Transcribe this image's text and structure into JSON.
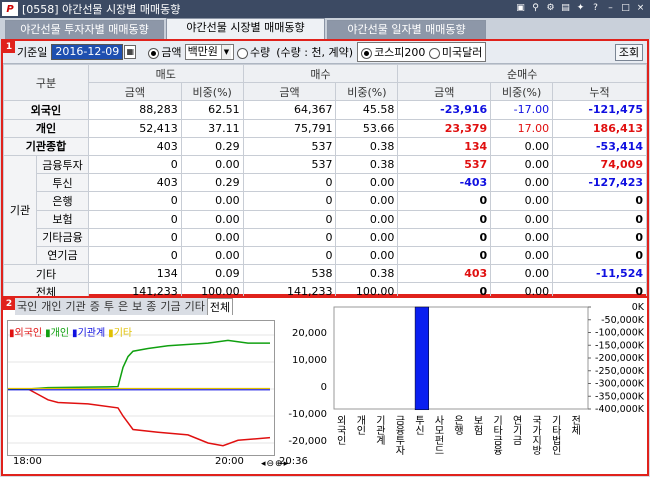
{
  "window": {
    "title": "[0558] 야간선물 시장별 매매동향",
    "app_icon": "P"
  },
  "tabs": [
    "야간선물 투자자별 매매동향",
    "야간선물 시장별 매매동향",
    "야간선물 일자별 매매동향"
  ],
  "filter": {
    "date_label": "기준일",
    "date": "2016-12-09",
    "amount_label": "금액",
    "unit": "백만원",
    "qty_label": "수량",
    "qty_note": "(수량 : 천, 계약)",
    "kospi": "코스피200",
    "usd": "미국달러",
    "query": "조회"
  },
  "grid": {
    "h1": [
      "구분",
      "매도",
      "매수",
      "순매수"
    ],
    "h2": [
      "금액",
      "비중(%)",
      "금액",
      "비중(%)",
      "금액",
      "비중(%)",
      "누적"
    ],
    "group_label": "기관",
    "rows": [
      {
        "name": "외국인",
        "v": [
          "88,283",
          "62.51",
          "64,367",
          "45.58",
          "-23,916",
          "-17.00",
          "-121,475"
        ]
      },
      {
        "name": "개인",
        "v": [
          "52,413",
          "37.11",
          "75,791",
          "53.66",
          "23,379",
          "17.00",
          "186,413"
        ]
      },
      {
        "name": "기관종합",
        "v": [
          "403",
          "0.29",
          "537",
          "0.38",
          "134",
          "0.00",
          "-53,414"
        ]
      },
      {
        "name": "금융투자",
        "v": [
          "0",
          "0.00",
          "537",
          "0.38",
          "537",
          "0.00",
          "74,009"
        ]
      },
      {
        "name": "투신",
        "v": [
          "403",
          "0.29",
          "0",
          "0.00",
          "-403",
          "0.00",
          "-127,423"
        ]
      },
      {
        "name": "은행",
        "v": [
          "0",
          "0.00",
          "0",
          "0.00",
          "0",
          "0.00",
          "0"
        ]
      },
      {
        "name": "보험",
        "v": [
          "0",
          "0.00",
          "0",
          "0.00",
          "0",
          "0.00",
          "0"
        ]
      },
      {
        "name": "기타금융",
        "v": [
          "0",
          "0.00",
          "0",
          "0.00",
          "0",
          "0.00",
          "0"
        ]
      },
      {
        "name": "연기금",
        "v": [
          "0",
          "0.00",
          "0",
          "0.00",
          "0",
          "0.00",
          "0"
        ]
      },
      {
        "name": "기타",
        "v": [
          "134",
          "0.09",
          "538",
          "0.38",
          "403",
          "0.00",
          "-11,524"
        ]
      },
      {
        "name": "전체",
        "v": [
          "141,233",
          "100.00",
          "141,233",
          "100.00",
          "0",
          "0.00",
          "0"
        ]
      }
    ]
  },
  "panel2": {
    "tabs": [
      "국인",
      "개인",
      "기관",
      "증",
      "투",
      "은",
      "보",
      "종",
      "기금",
      "기타",
      "전체"
    ],
    "legend": [
      "외국인",
      "개인",
      "기관계",
      "기타"
    ],
    "colors": {
      "foreign": "#e01010",
      "individual": "#10a010",
      "institution": "#1010e0",
      "other": "#e0c000"
    }
  },
  "chart_data": [
    {
      "type": "line",
      "series": [
        {
          "name": "외국인"
        },
        {
          "name": "개인"
        },
        {
          "name": "기관계"
        },
        {
          "name": "기타"
        }
      ],
      "y_ticks": [
        "20,000",
        "10,000",
        "0",
        "-10,000",
        "-20,000"
      ],
      "x_ticks": [
        "18:00",
        "20:00",
        "20:36"
      ]
    },
    {
      "type": "bar",
      "categories": [
        "외국인",
        "개인",
        "기관계",
        "금융투자",
        "투신",
        "사모펀드",
        "은행",
        "보험",
        "기타금융",
        "연기금",
        "국가지방",
        "기타법인",
        "전체"
      ],
      "values": [
        0,
        0,
        0,
        0,
        -403,
        0,
        0,
        0,
        0,
        0,
        0,
        0,
        0
      ],
      "y_ticks": [
        "0K",
        "-50,000K",
        "-100,000K",
        "-150,000K",
        "-200,000K",
        "-250,000K",
        "-300,000K",
        "-350,000K",
        "-400,000K"
      ]
    }
  ],
  "badges": [
    "1",
    "2"
  ]
}
